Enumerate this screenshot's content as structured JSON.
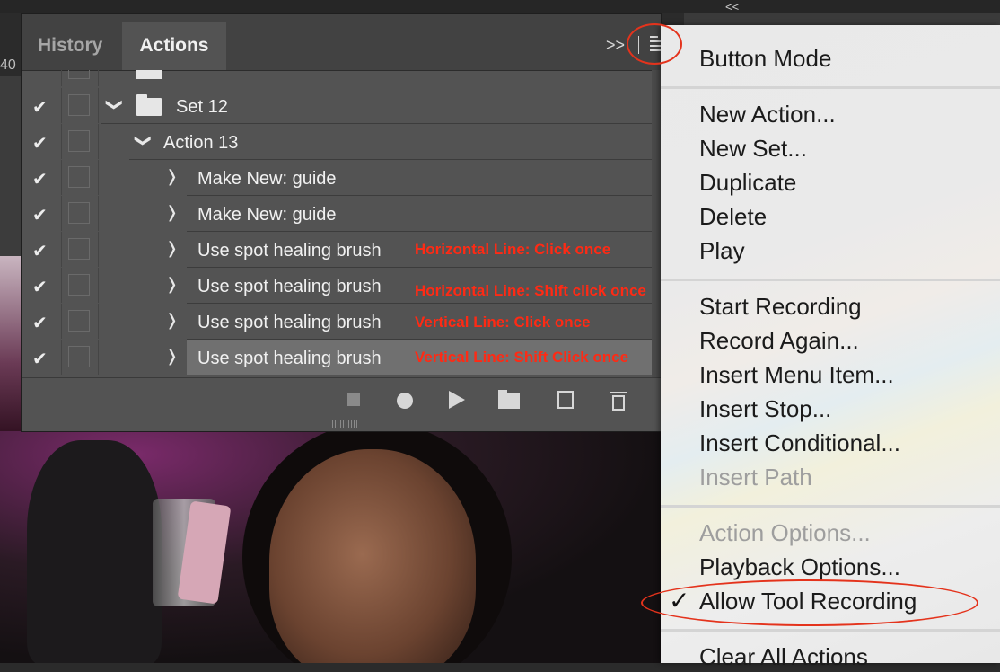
{
  "ruler_number": "40",
  "dock_collapse": "<<",
  "tabs": [
    {
      "label": "History",
      "active": false
    },
    {
      "label": "Actions",
      "active": true
    }
  ],
  "panel_expand": ">>",
  "rows": [
    {
      "label": "Set 12",
      "kind": "set",
      "checked": true
    },
    {
      "label": "Action 13",
      "kind": "action",
      "checked": true
    },
    {
      "label": "Make New: guide",
      "kind": "step",
      "checked": true
    },
    {
      "label": "Make New: guide",
      "kind": "step",
      "checked": true
    },
    {
      "label": "Use spot healing brush",
      "kind": "step",
      "checked": true,
      "annotation": "Horizontal Line: Click once"
    },
    {
      "label": "Use spot healing brush",
      "kind": "step",
      "checked": true,
      "annotation": "Horizontal Line: Shift click once"
    },
    {
      "label": "Use spot healing brush",
      "kind": "step",
      "checked": true,
      "annotation": "Vertical Line: Click once"
    },
    {
      "label": "Use spot healing brush",
      "kind": "step",
      "checked": true,
      "selected": true,
      "annotation": "Vertical Line: Shift Click once"
    }
  ],
  "footer_icons": [
    "stop-icon",
    "record-icon",
    "play-icon",
    "new-set-icon",
    "new-action-icon",
    "trash-icon"
  ],
  "menu": {
    "button_mode": "Button Mode",
    "new_action": "New Action...",
    "new_set": "New Set...",
    "duplicate": "Duplicate",
    "delete": "Delete",
    "play": "Play",
    "start_recording": "Start Recording",
    "record_again": "Record Again...",
    "insert_menu_item": "Insert Menu Item...",
    "insert_stop": "Insert Stop...",
    "insert_conditional": "Insert Conditional...",
    "insert_path": "Insert Path",
    "action_options": "Action Options...",
    "playback_options": "Playback Options...",
    "allow_tool_recording": "Allow Tool Recording",
    "allow_tool_recording_checked": true,
    "clear_all_actions": "Clear All Actions",
    "check_mark": "✓"
  },
  "annotation_color": "#ff2a14"
}
